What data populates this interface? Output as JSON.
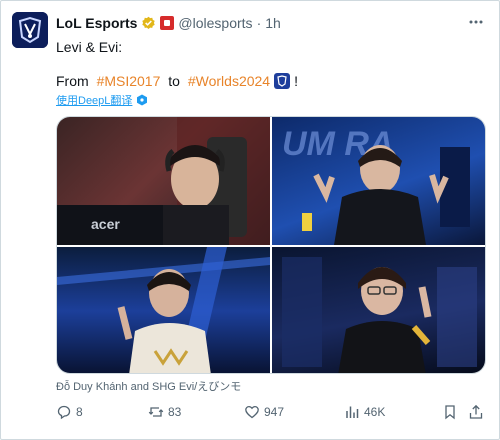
{
  "account": {
    "name": "LoL Esports",
    "handle": "@lolesports",
    "separator": "·",
    "time": "1h"
  },
  "tweet": {
    "line1": "Levi & Evi:",
    "line2_prefix": "From ",
    "tag1": "#MSI2017",
    "line2_mid": " to ",
    "tag2": "#Worlds2024",
    "line2_suffix": "!"
  },
  "translate_label": "使用DeepL翻译",
  "media_caption": "Đỗ Duy Khánh and SHG Evi/えびンモ",
  "actions": {
    "replies": "8",
    "reposts": "83",
    "likes": "947",
    "views": "46K"
  },
  "colors": {
    "accent": "#1d9bf0",
    "hashtag": "#e8842a",
    "text": "#0f1419",
    "muted": "#536471",
    "verified": "#e2b719"
  }
}
